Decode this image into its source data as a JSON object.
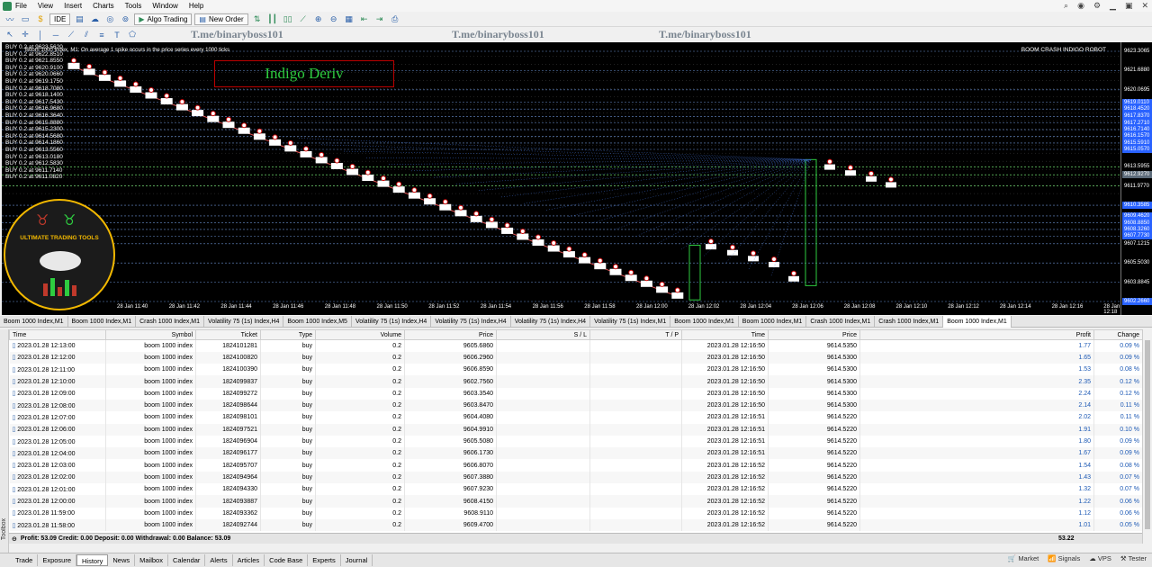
{
  "menu": [
    "File",
    "View",
    "Insert",
    "Charts",
    "Tools",
    "Window",
    "Help"
  ],
  "toolbar": {
    "ide": "IDE",
    "algo": "Algo Trading",
    "new_order": "New Order"
  },
  "watermarks": [
    "T.me/binaryboss101",
    "T.me/binaryboss101",
    "T.me/binaryboss101"
  ],
  "chart": {
    "title": "Boom 1000 Index, M1: On average 1 spike occurs in the price series every 1000 ticks",
    "robot_label": "BOOM CRASH INDIGO ROBOT",
    "brand": "Indigo Deriv",
    "logo_text": "ULTIMATE TRADING TOOLS",
    "buy_orders": [
      "BUY 0.2 at 9623.5620",
      "BUY 0.2 at 9622.8510",
      "BUY 0.2 at 9621.8550",
      "BUY 0.2 at 9620.9100",
      "BUY 0.2 at 9620.0660",
      "BUY 0.2 at 9619.1750",
      "BUY 0.2 at 9618.7080",
      "BUY 0.2 at 9618.1400",
      "BUY 0.2 at 9617.5430",
      "BUY 0.2 at 9616.9680",
      "BUY 0.2 at 9616.3640",
      "BUY 0.2 at 9615.8880",
      "BUY 0.2 at 9615.2300",
      "BUY 0.2 at 9614.5680",
      "BUY 0.2 at 9614.1860",
      "BUY 0.2 at 9613.5560",
      "BUY 0.2 at 9613.0180",
      "BUY 0.2 at 9612.5830",
      "BUY 0.2 at 9611.7140",
      "BUY 0.2 at 9611.0820"
    ],
    "price_labels": [
      "9623.3065",
      "9621.6880",
      "9620.0695",
      "9619.0110",
      "9618.4520",
      "9617.8370",
      "9617.2710",
      "9616.7140",
      "9616.1570",
      "9615.5910",
      "9615.0570",
      "9613.5955",
      "9612.9270",
      "9611.9770",
      "9610.3585",
      "9609.4620",
      "9608.8850",
      "9608.3260",
      "9607.7730",
      "9607.1215",
      "9605.5030",
      "9603.8845",
      "9602.2660"
    ],
    "x_labels": [
      "28 Jan 11:40",
      "28 Jan 11:42",
      "28 Jan 11:44",
      "28 Jan 11:46",
      "28 Jan 11:48",
      "28 Jan 11:50",
      "28 Jan 11:52",
      "28 Jan 11:54",
      "28 Jan 11:56",
      "28 Jan 11:58",
      "28 Jan 12:00",
      "28 Jan 12:02",
      "28 Jan 12:04",
      "28 Jan 12:06",
      "28 Jan 12:08",
      "28 Jan 12:10",
      "28 Jan 12:12",
      "28 Jan 12:14",
      "28 Jan 12:16",
      "28 Jan 12:18",
      "28 Jan 12:20"
    ]
  },
  "chart_tabs": [
    "Boom 1000 Index,M1",
    "Boom 1000 Index,M1",
    "Crash 1000 Index,M1",
    "Volatility 75 (1s) Index,H4",
    "Boom 1000 Index,M5",
    "Volatility 75 (1s) Index,H4",
    "Volatility 75 (1s) Index,H4",
    "Volatility 75 (1s) Index,H4",
    "Volatility 75 (1s) Index,M1",
    "Boom 1000 Index,M1",
    "Boom 1000 Index,M1",
    "Crash 1000 Index,M1",
    "Crash 1000 Index,M1",
    "Boom 1000 Index,M1"
  ],
  "table": {
    "headers": [
      "Time",
      "Symbol",
      "Ticket",
      "Type",
      "Volume",
      "Price",
      "S / L",
      "T / P",
      "Time",
      "Price",
      "Profit",
      "Change"
    ],
    "rows": [
      [
        "2023.01.28 12:13:00",
        "boom 1000 index",
        "1824101281",
        "buy",
        "0.2",
        "9605.6860",
        "",
        "",
        "2023.01.28 12:16:50",
        "9614.5350",
        "1.77",
        "0.09 %"
      ],
      [
        "2023.01.28 12:12:00",
        "boom 1000 index",
        "1824100820",
        "buy",
        "0.2",
        "9606.2960",
        "",
        "",
        "2023.01.28 12:16:50",
        "9614.5300",
        "1.65",
        "0.09 %"
      ],
      [
        "2023.01.28 12:11:00",
        "boom 1000 index",
        "1824100390",
        "buy",
        "0.2",
        "9606.8590",
        "",
        "",
        "2023.01.28 12:16:50",
        "9614.5300",
        "1.53",
        "0.08 %"
      ],
      [
        "2023.01.28 12:10:00",
        "boom 1000 index",
        "1824099837",
        "buy",
        "0.2",
        "9602.7560",
        "",
        "",
        "2023.01.28 12:16:50",
        "9614.5300",
        "2.35",
        "0.12 %"
      ],
      [
        "2023.01.28 12:09:00",
        "boom 1000 index",
        "1824099272",
        "buy",
        "0.2",
        "9603.3540",
        "",
        "",
        "2023.01.28 12:16:50",
        "9614.5300",
        "2.24",
        "0.12 %"
      ],
      [
        "2023.01.28 12:08:00",
        "boom 1000 index",
        "1824098644",
        "buy",
        "0.2",
        "9603.8470",
        "",
        "",
        "2023.01.28 12:16:50",
        "9614.5300",
        "2.14",
        "0.11 %"
      ],
      [
        "2023.01.28 12:07:00",
        "boom 1000 index",
        "1824098101",
        "buy",
        "0.2",
        "9604.4080",
        "",
        "",
        "2023.01.28 12:16:51",
        "9614.5220",
        "2.02",
        "0.11 %"
      ],
      [
        "2023.01.28 12:06:00",
        "boom 1000 index",
        "1824097521",
        "buy",
        "0.2",
        "9604.9910",
        "",
        "",
        "2023.01.28 12:16:51",
        "9614.5220",
        "1.91",
        "0.10 %"
      ],
      [
        "2023.01.28 12:05:00",
        "boom 1000 index",
        "1824096904",
        "buy",
        "0.2",
        "9605.5080",
        "",
        "",
        "2023.01.28 12:16:51",
        "9614.5220",
        "1.80",
        "0.09 %"
      ],
      [
        "2023.01.28 12:04:00",
        "boom 1000 index",
        "1824096177",
        "buy",
        "0.2",
        "9606.1730",
        "",
        "",
        "2023.01.28 12:16:51",
        "9614.5220",
        "1.67",
        "0.09 %"
      ],
      [
        "2023.01.28 12:03:00",
        "boom 1000 index",
        "1824095707",
        "buy",
        "0.2",
        "9606.8070",
        "",
        "",
        "2023.01.28 12:16:52",
        "9614.5220",
        "1.54",
        "0.08 %"
      ],
      [
        "2023.01.28 12:02:00",
        "boom 1000 index",
        "1824094964",
        "buy",
        "0.2",
        "9607.3880",
        "",
        "",
        "2023.01.28 12:16:52",
        "9614.5220",
        "1.43",
        "0.07 %"
      ],
      [
        "2023.01.28 12:01:00",
        "boom 1000 index",
        "1824094330",
        "buy",
        "0.2",
        "9607.9230",
        "",
        "",
        "2023.01.28 12:16:52",
        "9614.5220",
        "1.32",
        "0.07 %"
      ],
      [
        "2023.01.28 12:00:00",
        "boom 1000 index",
        "1824093887",
        "buy",
        "0.2",
        "9608.4150",
        "",
        "",
        "2023.01.28 12:16:52",
        "9614.5220",
        "1.22",
        "0.06 %"
      ],
      [
        "2023.01.28 11:59:00",
        "boom 1000 index",
        "1824093362",
        "buy",
        "0.2",
        "9608.9110",
        "",
        "",
        "2023.01.28 12:16:52",
        "9614.5220",
        "1.12",
        "0.06 %"
      ],
      [
        "2023.01.28 11:58:00",
        "boom 1000 index",
        "1824092744",
        "buy",
        "0.2",
        "9609.4700",
        "",
        "",
        "2023.01.28 12:16:52",
        "9614.5220",
        "1.01",
        "0.05 %"
      ]
    ]
  },
  "summary": {
    "text": "Profit: 53.09  Credit: 0.00  Deposit: 0.00  Withdrawal: 0.00  Balance: 53.09",
    "total": "53.22"
  },
  "bottom_tabs": [
    "Trade",
    "Exposure",
    "History",
    "News",
    "Mailbox",
    "Calendar",
    "Alerts",
    "Articles",
    "Code Base",
    "Experts",
    "Journal"
  ],
  "status": [
    "Market",
    "Signals",
    "VPS",
    "Tester"
  ],
  "toolbox_label": "Toolbox"
}
